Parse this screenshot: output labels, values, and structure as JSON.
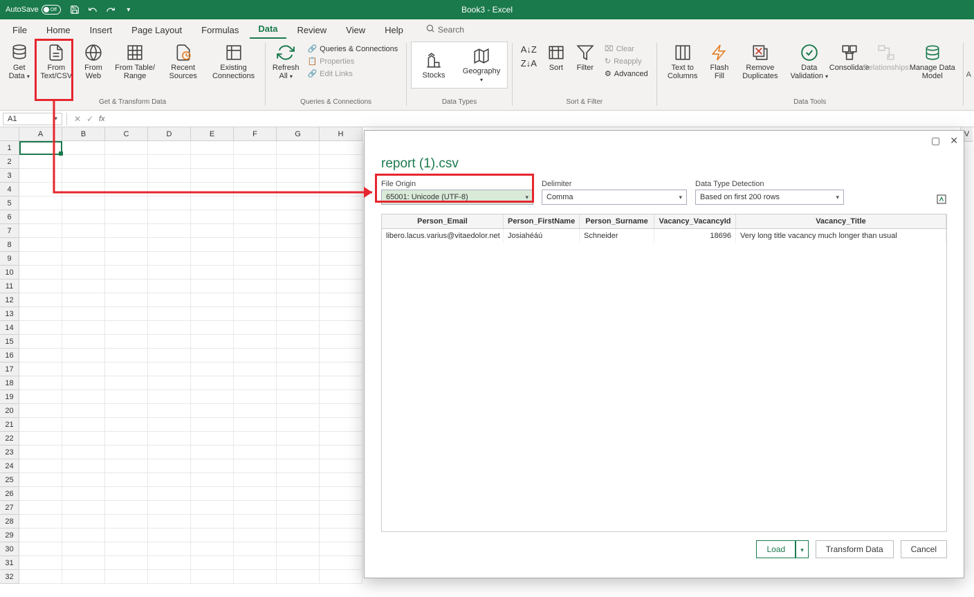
{
  "title_bar": {
    "autosave_label": "AutoSave",
    "autosave_state": "Off",
    "doc_title": "Book3 - Excel"
  },
  "ribbon_tabs": [
    "File",
    "Home",
    "Insert",
    "Page Layout",
    "Formulas",
    "Data",
    "Review",
    "View",
    "Help"
  ],
  "active_tab": "Data",
  "search_label": "Search",
  "ribbon": {
    "get_transform": {
      "get_data": "Get Data",
      "from_text_csv": "From Text/CSV",
      "from_web": "From Web",
      "from_table": "From Table/ Range",
      "recent": "Recent Sources",
      "existing": "Existing Connections",
      "group_label": "Get & Transform Data"
    },
    "queries": {
      "refresh": "Refresh All",
      "qc": "Queries & Connections",
      "props": "Properties",
      "links": "Edit Links",
      "group_label": "Queries & Connections"
    },
    "data_types": {
      "stocks": "Stocks",
      "geography": "Geography",
      "group_label": "Data Types"
    },
    "sort_filter": {
      "sort": "Sort",
      "filter": "Filter",
      "clear": "Clear",
      "reapply": "Reapply",
      "advanced": "Advanced",
      "group_label": "Sort & Filter"
    },
    "data_tools": {
      "ttc": "Text to Columns",
      "flash": "Flash Fill",
      "remove_dup": "Remove Duplicates",
      "validation": "Data Validation",
      "consolidate": "Consolidate",
      "relationships": "Relationships",
      "manage_dm": "Manage Data Model",
      "group_label": "Data Tools"
    }
  },
  "formula_bar": {
    "name_box": "A1"
  },
  "columns": [
    "A",
    "B",
    "C",
    "D",
    "E",
    "F",
    "G",
    "H"
  ],
  "rows": [
    1,
    2,
    3,
    4,
    5,
    6,
    7,
    8,
    9,
    10,
    11,
    12,
    13,
    14,
    15,
    16,
    17,
    18,
    19,
    20,
    21,
    22,
    23,
    24,
    25,
    26,
    27,
    28,
    29,
    30,
    31,
    32
  ],
  "selected_cell": "A1",
  "right_col_letter": "V",
  "dialog": {
    "title": "report (1).csv",
    "file_origin_label": "File Origin",
    "file_origin_value": "65001: Unicode (UTF-8)",
    "delimiter_label": "Delimiter",
    "delimiter_value": "Comma",
    "detection_label": "Data Type Detection",
    "detection_value": "Based on first 200 rows",
    "table": {
      "headers": [
        "Person_Email",
        "Person_FirstName",
        "Person_Surname",
        "Vacancy_VacancyId",
        "Vacancy_Title"
      ],
      "rows": [
        {
          "email": "libero.lacus.varius@vitaedolor.net",
          "first": "Josiahéáú",
          "last": "Schneider",
          "id": "18696",
          "title": "Very long title vacancy much longer than usual"
        }
      ]
    },
    "buttons": {
      "load": "Load",
      "transform": "Transform Data",
      "cancel": "Cancel"
    }
  }
}
